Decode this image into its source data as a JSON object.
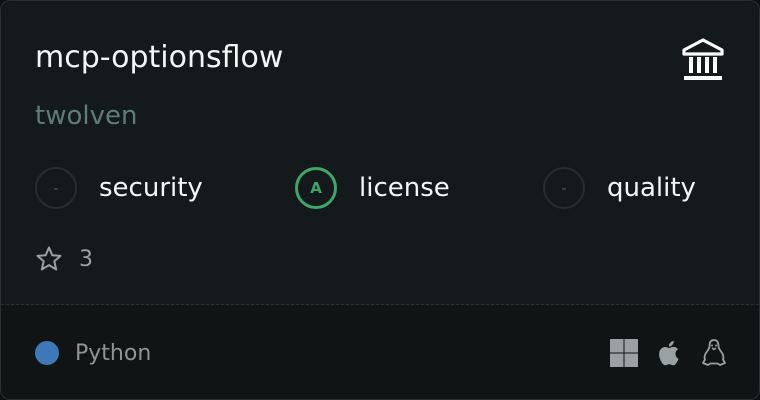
{
  "repo": {
    "name": "mcp-optionsflow",
    "owner": "twolven"
  },
  "metrics": {
    "security": {
      "grade": "-",
      "label": "security"
    },
    "license": {
      "grade": "A",
      "label": "license"
    },
    "quality": {
      "grade": "-",
      "label": "quality"
    }
  },
  "stars": {
    "count": "3",
    "icon": "star-icon"
  },
  "language": {
    "name": "Python",
    "color": "#3e78b7"
  },
  "platforms": [
    "windows",
    "apple",
    "linux"
  ],
  "colors": {
    "grade_a": "#3fa56c",
    "owner": "#5f7d78",
    "background": "#14191b"
  }
}
